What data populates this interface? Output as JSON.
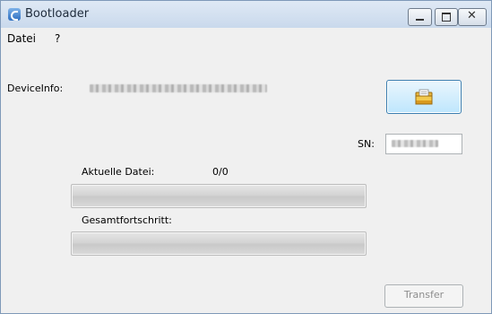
{
  "window": {
    "title": "Bootloader"
  },
  "menu": {
    "items": [
      "Datei",
      "?"
    ]
  },
  "device": {
    "label": "DeviceInfo:",
    "value": "[redacted]"
  },
  "sn": {
    "label": "SN:",
    "value": "[redacted]"
  },
  "progress": {
    "current_file_label": "Aktuelle Datei:",
    "current_file_count": "0/0",
    "current_file_fraction": 0,
    "total_label": "Gesamtfortschritt:",
    "total_fraction": 0
  },
  "buttons": {
    "transfer_label": "Transfer"
  },
  "icons": {
    "app": "bootloader-app-icon",
    "open": "folder-open-icon"
  }
}
